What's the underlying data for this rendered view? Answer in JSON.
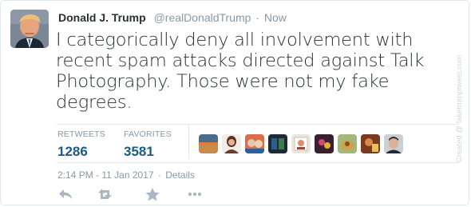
{
  "tweet": {
    "author_name": "Donald J. Trump",
    "handle": "@realDonaldTrump",
    "separator": "·",
    "time_ago": "Now",
    "text": "I categorically deny all involvement with recent spam attacks directed against Talk Photography.  Those were not my fake degrees.",
    "timestamp": "2:14 PM - 11 Jan 2017",
    "details_label": "Details"
  },
  "stats": {
    "retweets_label": "RETWEETS",
    "retweets_count": "1286",
    "favorites_label": "FAVORITES",
    "favorites_count": "3581"
  },
  "actions": {
    "icons": [
      "reply-icon",
      "retweet-icon",
      "favorite-icon",
      "more-icon"
    ]
  },
  "watermark": {
    "text": "Created @ faketrumptweet.com"
  },
  "colors": {
    "name": "#292f33",
    "muted": "#8899a6",
    "stat_value": "#1c5a8a",
    "border": "#e1e8ed",
    "icon": "#aab8c2"
  }
}
